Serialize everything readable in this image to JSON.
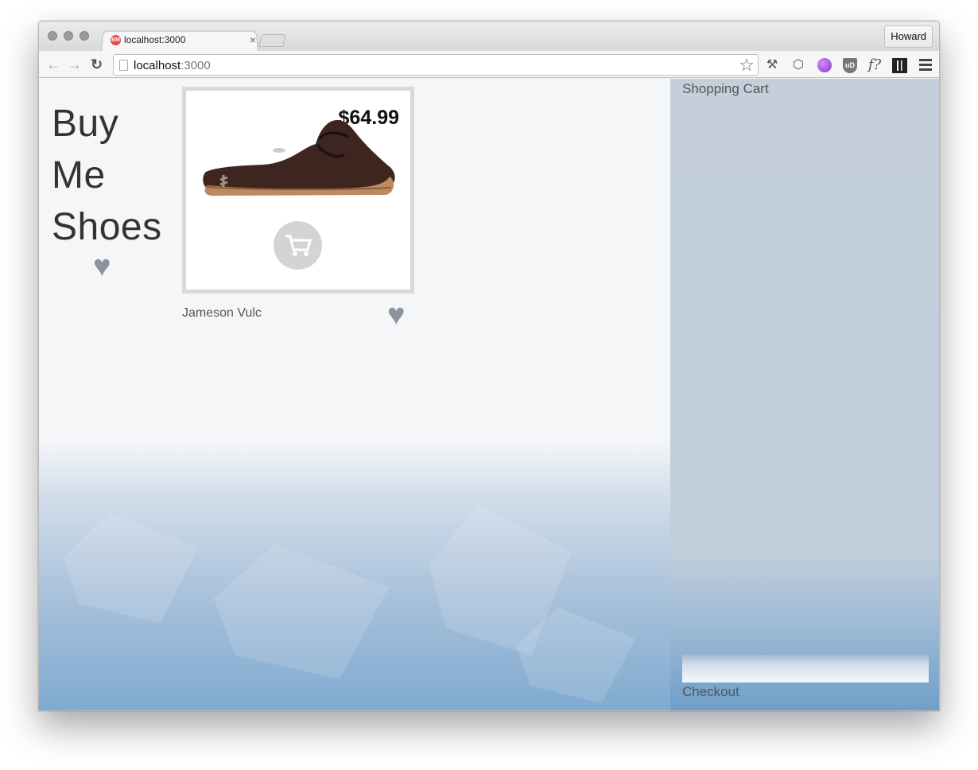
{
  "browser": {
    "tab_title": "localhost:3000",
    "tab_close": "×",
    "profile_name": "Howard",
    "address": {
      "host": "localhost",
      "port": ":3000"
    },
    "favicon_text": "BM",
    "icons": [
      "back-icon",
      "forward-icon",
      "reload-icon",
      "bookmark-star-icon",
      "wrench-icon",
      "pocket-icon",
      "globe-extension-icon",
      "ublock-icon",
      "font-question-icon",
      "qr-code-icon",
      "menu-icon"
    ]
  },
  "page": {
    "brand": {
      "line1": "Buy",
      "line2": "Me",
      "line3": "Shoes"
    },
    "product": {
      "price": "$64.99",
      "name": "Jameson Vulc"
    },
    "cart": {
      "title": "Shopping Cart",
      "checkout": "Checkout"
    },
    "colors": {
      "heart": "#8d929f",
      "cart_panel": "#c1cedb",
      "card_border": "#d9d9d9"
    }
  }
}
